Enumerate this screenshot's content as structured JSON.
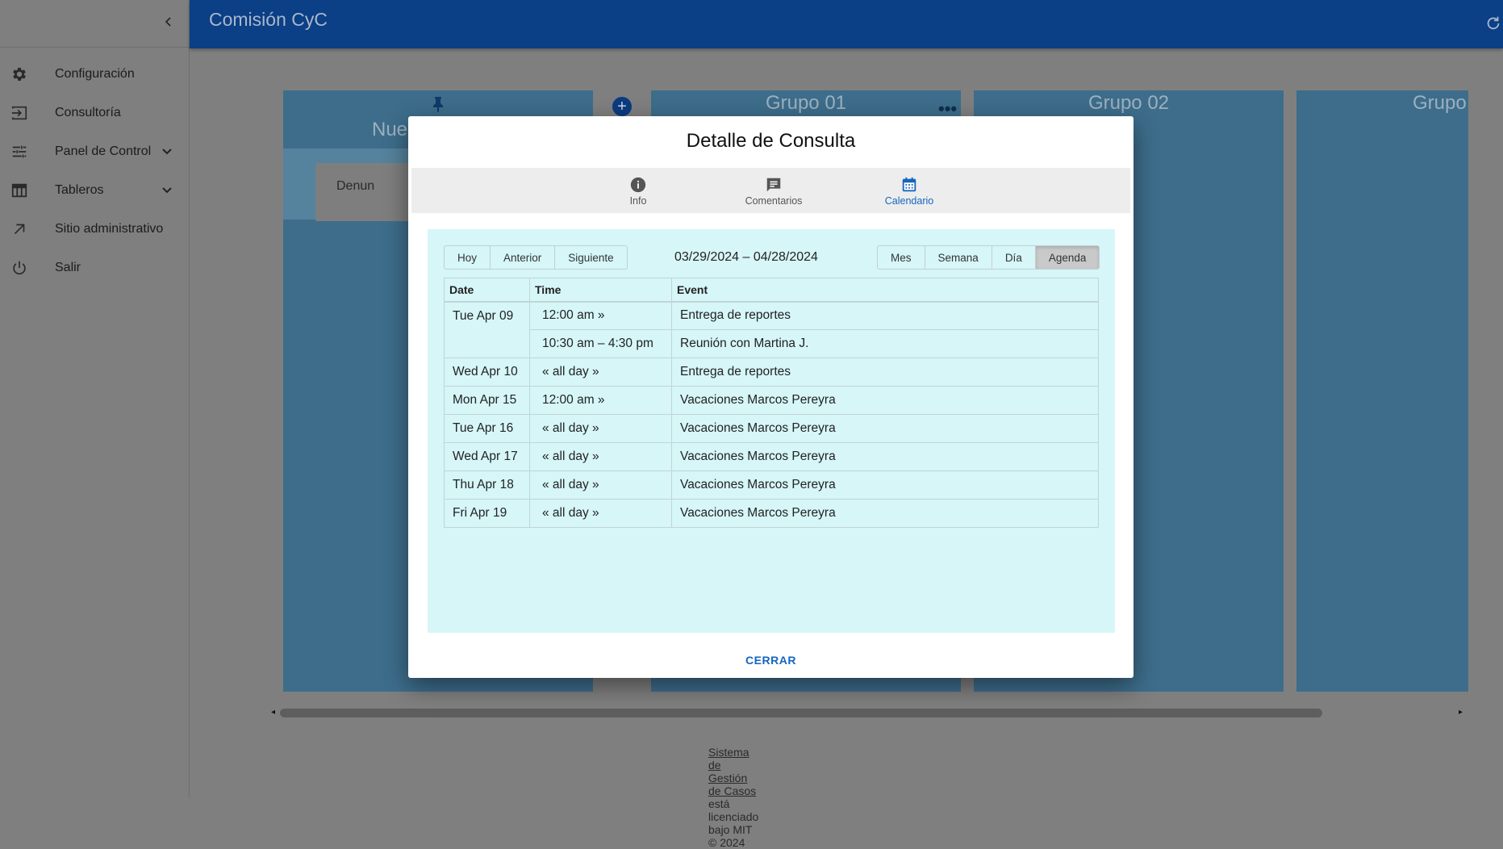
{
  "app": {
    "title": "Comisión CyC"
  },
  "sidebar": {
    "items": [
      {
        "label": "Configuración",
        "icon": "gear-icon",
        "has_chevron": false
      },
      {
        "label": "Consultoría",
        "icon": "login-icon",
        "has_chevron": false
      },
      {
        "label": "Panel de Control",
        "icon": "tune-icon",
        "has_chevron": true
      },
      {
        "label": "Tableros",
        "icon": "table-icon",
        "has_chevron": true
      },
      {
        "label": "Sitio administrativo",
        "icon": "arrow-up-right-icon",
        "has_chevron": false
      },
      {
        "label": "Salir",
        "icon": "power-icon",
        "has_chevron": false
      }
    ]
  },
  "board": {
    "columns": [
      {
        "title": "Nue",
        "card_text": "Denun"
      },
      {
        "title": "Grupo 01"
      },
      {
        "title": "Grupo 02"
      },
      {
        "title": "Grupo"
      }
    ],
    "add_column_symbol": "+"
  },
  "footer": {
    "link_text": "Sistema de Gestión de Casos",
    "rest_text": " está licenciado bajo MIT © 2024"
  },
  "modal": {
    "title": "Detalle de Consulta",
    "tabs": [
      {
        "label": "Info",
        "icon": "info-icon",
        "active": false
      },
      {
        "label": "Comentarios",
        "icon": "comment-icon",
        "active": false
      },
      {
        "label": "Calendario",
        "icon": "calendar-icon",
        "active": true
      }
    ],
    "calendar": {
      "nav_buttons": [
        "Hoy",
        "Anterior",
        "Siguiente"
      ],
      "date_range": "03/29/2024 – 04/28/2024",
      "view_buttons": [
        "Mes",
        "Semana",
        "Día",
        "Agenda"
      ],
      "active_view": "Agenda",
      "agenda_headers": {
        "date": "Date",
        "time": "Time",
        "event": "Event"
      },
      "agenda_rows": [
        {
          "date": "Tue Apr 09",
          "time": "12:00 am »",
          "event": "Entrega de reportes"
        },
        {
          "date": "",
          "time": "10:30 am – 4:30 pm",
          "event": "Reunión con Martina J."
        },
        {
          "date": "Wed Apr 10",
          "time": "« all day »",
          "event": "Entrega de reportes"
        },
        {
          "date": "Mon Apr 15",
          "time": "12:00 am »",
          "event": "Vacaciones Marcos Pereyra"
        },
        {
          "date": "Tue Apr 16",
          "time": "« all day »",
          "event": "Vacaciones Marcos Pereyra"
        },
        {
          "date": "Wed Apr 17",
          "time": "« all day »",
          "event": "Vacaciones Marcos Pereyra"
        },
        {
          "date": "Thu Apr 18",
          "time": "« all day »",
          "event": "Vacaciones Marcos Pereyra"
        },
        {
          "date": "Fri Apr 19",
          "time": "« all day »",
          "event": "Vacaciones Marcos Pereyra"
        }
      ]
    },
    "close_label": "CERRAR"
  },
  "colors": {
    "appbar": "#0b3f86",
    "accent": "#1565c0",
    "calendar_bg": "#d6f6f8",
    "column_bg": "#3d6d8b"
  }
}
